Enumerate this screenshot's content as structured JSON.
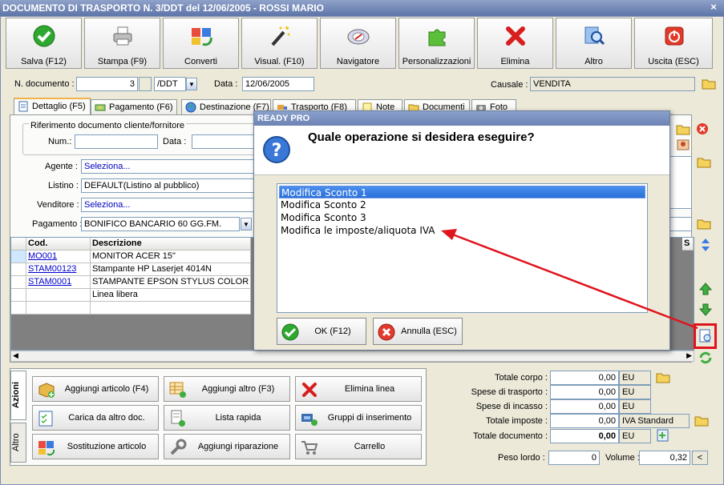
{
  "window": {
    "title": "DOCUMENTO DI TRASPORTO N. 3/DDT del 12/06/2005 - ROSSI MARIO",
    "close": "×"
  },
  "toolbar": [
    {
      "label": "Salva (F12)",
      "icon": "check-icon"
    },
    {
      "label": "Stampa (F9)",
      "icon": "printer-icon"
    },
    {
      "label": "Converti",
      "icon": "convert-icon"
    },
    {
      "label": "Visual. (F10)",
      "icon": "magic-wand-icon"
    },
    {
      "label": "Navigatore",
      "icon": "compass-icon"
    },
    {
      "label": "Personalizzazioni",
      "icon": "puzzle-icon"
    },
    {
      "label": "Elimina",
      "icon": "delete-x-icon"
    },
    {
      "label": "Altro",
      "icon": "magnifier-icon"
    },
    {
      "label": "Uscita (ESC)",
      "icon": "power-icon"
    }
  ],
  "header": {
    "ndoc_label": "N. documento :",
    "ndoc_value": "3",
    "ndoc_suffix": "/DDT",
    "data_label": "Data :",
    "data_value": "12/06/2005",
    "causale_label": "Causale :",
    "causale_value": "VENDITA"
  },
  "tabs": [
    {
      "label": "Dettaglio (F5)"
    },
    {
      "label": "Pagamento (F6)"
    },
    {
      "label": "Destinazione (F7)"
    },
    {
      "label": "Trasporto (F8)"
    },
    {
      "label": "Note"
    },
    {
      "label": "Documenti"
    },
    {
      "label": "Foto"
    }
  ],
  "detail": {
    "rif_label": "Riferimento documento cliente/fornitore",
    "num_label": "Num.:",
    "data_label": "Data :",
    "agente_label": "Agente :",
    "agente_value": "Seleziona...",
    "listino_label": "Listino :",
    "listino_value": "DEFAULT(Listino al pubblico)",
    "venditore_label": "Venditore :",
    "venditore_value": "Seleziona...",
    "pagamento_label": "Pagamento :",
    "pagamento_value": "BONIFICO BANCARIO 60 GG.FM."
  },
  "grid": {
    "headers": [
      "Cod.",
      "Descrizione",
      "S"
    ],
    "rows": [
      {
        "cod": "MO001",
        "desc": "MONITOR ACER 15\""
      },
      {
        "cod": "STAM00123",
        "desc": "Stampante HP Laserjet 4014N"
      },
      {
        "cod": "STAM0001",
        "desc": "STAMPANTE EPSON STYLUS COLOR C..."
      },
      {
        "cod": "",
        "desc": "Linea libera"
      },
      {
        "cod": "",
        "desc": ""
      }
    ]
  },
  "actions": {
    "tab_azioni": "Azioni",
    "tab_altro": "Altro",
    "buttons": [
      {
        "label": "Aggiungi articolo (F4)"
      },
      {
        "label": "Aggiungi altro (F3)"
      },
      {
        "label": "Elimina linea"
      },
      {
        "label": "Carica da altro doc."
      },
      {
        "label": "Lista rapida"
      },
      {
        "label": "Gruppi di inserimento"
      },
      {
        "label": "Sostituzione articolo"
      },
      {
        "label": "Aggiungi riparazione"
      },
      {
        "label": "Carrello"
      }
    ]
  },
  "totals": {
    "corpo_label": "Totale corpo :",
    "corpo_value": "0,00",
    "corpo_unit": "EU",
    "trasporto_label": "Spese di trasporto :",
    "trasporto_value": "0,00",
    "trasporto_unit": "EU",
    "incasso_label": "Spese di incasso :",
    "incasso_value": "0,00",
    "incasso_unit": "EU",
    "imposte_label": "Totale imposte :",
    "imposte_value": "0,00",
    "imposte_unit": "IVA Standard",
    "documento_label": "Totale documento :",
    "documento_value": "0,00",
    "documento_unit": "EU",
    "peso_label": "Peso lordo :",
    "peso_value": "0",
    "volume_label": "Volume :",
    "volume_value": "0,32",
    "volume_btn": "<"
  },
  "dialog": {
    "title": "READY PRO",
    "question": "Quale operazione si desidera eseguire?",
    "options": [
      "Modifica Sconto 1",
      "Modifica Sconto 2",
      "Modifica Sconto 3",
      "Modifica le imposte/aliquota IVA"
    ],
    "selected_index": 0,
    "ok_label": "OK (F12)",
    "cancel_label": "Annulla (ESC)"
  },
  "colors": {
    "annotation": "#e0141e",
    "selection": "#316ac5",
    "link": "#0000d0"
  }
}
